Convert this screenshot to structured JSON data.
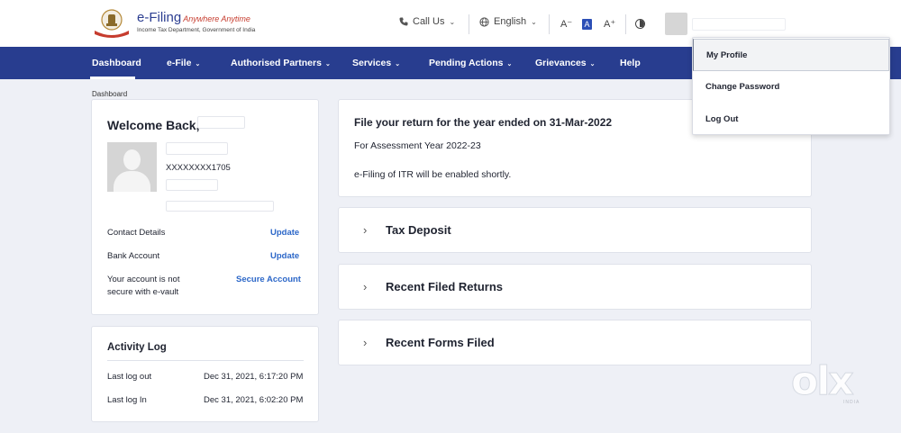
{
  "header": {
    "brand_name": "e-Filing",
    "brand_tagline": "Anywhere Anytime",
    "brand_dept": "Income Tax Department, Government of India",
    "call_us_label": "Call Us",
    "language_label": "English",
    "font_decrease": "A⁻",
    "font_normal": "A",
    "font_increase": "A⁺"
  },
  "nav": {
    "items": [
      {
        "label": "Dashboard",
        "active": true
      },
      {
        "label": "e-File",
        "has_dropdown": true
      },
      {
        "label": "Authorised Partners",
        "has_dropdown": true
      },
      {
        "label": "Services",
        "has_dropdown": true
      },
      {
        "label": "Pending Actions",
        "has_dropdown": true
      },
      {
        "label": "Grievances",
        "has_dropdown": true
      },
      {
        "label": "Help"
      }
    ]
  },
  "breadcrumb": "Dashboard",
  "welcome": {
    "title": "Welcome Back,",
    "pan_masked": "XXXXXXXX1705",
    "contact_label": "Contact Details",
    "contact_action": "Update",
    "bank_label": "Bank Account",
    "bank_action": "Update",
    "secure_line1": "Your account is not",
    "secure_line2": "secure with e-vault",
    "secure_action": "Secure Account"
  },
  "activity": {
    "title": "Activity Log",
    "rows": [
      {
        "label": "Last log out",
        "value": "Dec 31, 2021, 6:17:20 PM"
      },
      {
        "label": "Last log In",
        "value": "Dec 31, 2021, 6:02:20 PM"
      }
    ]
  },
  "file_return": {
    "title": "File your return for the year ended on 31-Mar-2022",
    "assessment_year": "For Assessment Year 2022-23",
    "status": "e-Filing of ITR will be enabled shortly."
  },
  "accordions": [
    {
      "label": "Tax Deposit"
    },
    {
      "label": "Recent Filed Returns"
    },
    {
      "label": "Recent Forms Filed"
    }
  ],
  "profile_menu": {
    "items": [
      {
        "label": "My Profile",
        "hover": true
      },
      {
        "label": "Change Password"
      },
      {
        "label": "Log Out"
      }
    ]
  },
  "watermark": {
    "text": "olx",
    "sub": "INDIA"
  },
  "colors": {
    "nav_bg": "#283d8f",
    "link": "#2c67c8",
    "brand": "#2c3e91",
    "tagline": "#c63c2e"
  }
}
